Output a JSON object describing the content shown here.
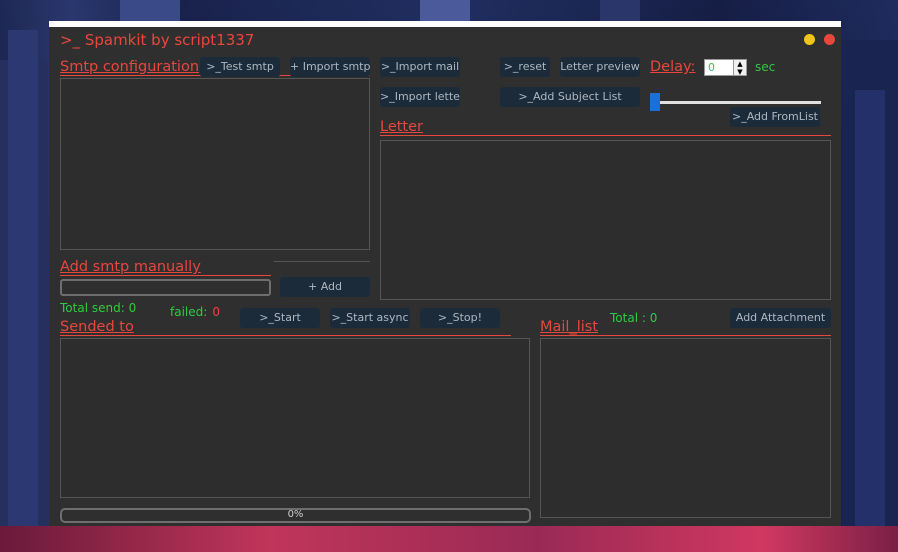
{
  "window": {
    "title": ">_ Spamkit by script1337",
    "colors": {
      "accent": "#e8473d",
      "success": "#2ecc40",
      "button_bg": "#1c2b3a",
      "window_bg": "#2f2f2f",
      "minimize": "#f0c419",
      "close": "#e8473d"
    }
  },
  "smtp": {
    "title": "Smtp configuration",
    "test_button": ">_Test smtp",
    "import_button": "+ Import smtp"
  },
  "toolbar": {
    "import_mail": ">_Import mail",
    "reset": ">_reset",
    "letter_preview": "Letter preview",
    "import_letter": ">_Import letter",
    "add_subject_list": ">_Add Subject List",
    "add_from_list": ">_Add FromList"
  },
  "delay": {
    "label": "Delay:",
    "value": "0",
    "unit": "sec",
    "slider_level": 0
  },
  "letter": {
    "title": "Letter"
  },
  "manual": {
    "title": "Add smtp manually",
    "input_value": "",
    "add_button": "+ Add"
  },
  "stats": {
    "total_send_label": "Total send:",
    "total_send_value": "0",
    "failed_label": "failed:",
    "failed_value": "0",
    "total_label": "Total : 0"
  },
  "actions": {
    "start": ">_Start",
    "start_async": ">_Start async",
    "stop": ">_Stop!",
    "add_attachment": "Add Attachment"
  },
  "sended": {
    "title": "Sended to"
  },
  "mail_list": {
    "title": "Mail_list"
  },
  "progress": {
    "value": "0%",
    "fraction": 0
  }
}
